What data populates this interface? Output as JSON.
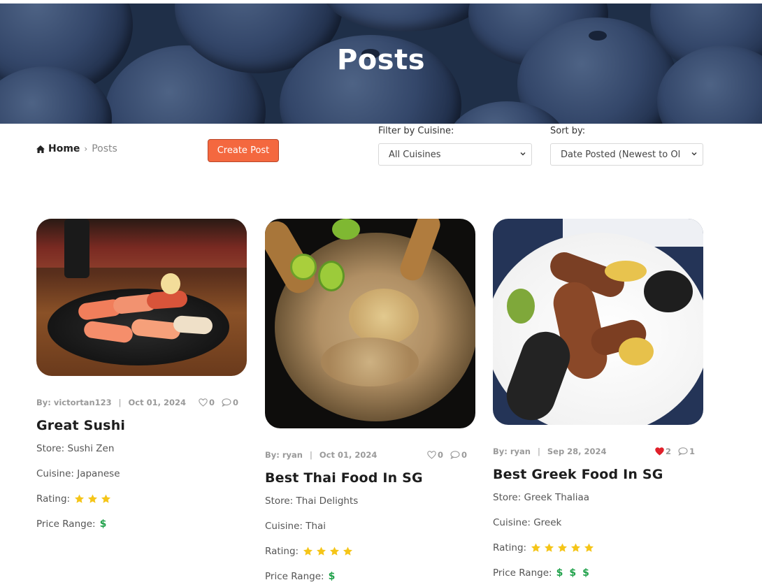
{
  "hero": {
    "title": "Posts"
  },
  "breadcrumb": {
    "home": "Home",
    "current": "Posts"
  },
  "toolbar": {
    "create_label": "Create Post",
    "filter_label": "Filter by Cuisine:",
    "filter_value": "All Cuisines",
    "sort_label": "Sort by:",
    "sort_value": "Date Posted (Newest to Ol"
  },
  "posts": [
    {
      "author": "By: victortan123",
      "date": "Oct 01, 2024",
      "likes": "0",
      "comments": "0",
      "liked": false,
      "title": "Great Sushi",
      "store": "Store: Sushi Zen",
      "cuisine": "Cuisine: Japanese",
      "rating_label": "Rating:",
      "rating": 3,
      "price_label": "Price Range:",
      "price": 1
    },
    {
      "author": "By: ryan",
      "date": "Oct 01, 2024",
      "likes": "0",
      "comments": "0",
      "liked": false,
      "title": "Best Thai Food In SG",
      "store": "Store: Thai Delights",
      "cuisine": "Cuisine: Thai",
      "rating_label": "Rating:",
      "rating": 4,
      "price_label": "Price Range:",
      "price": 1
    },
    {
      "author": "By: ryan",
      "date": "Sep 28, 2024",
      "likes": "2",
      "comments": "1",
      "liked": true,
      "title": "Best Greek Food In SG",
      "store": "Store: Greek Thaliaa",
      "cuisine": "Cuisine: Greek",
      "rating_label": "Rating:",
      "rating": 5,
      "price_label": "Price Range:",
      "price": 3
    }
  ],
  "icons": {
    "home": "home-icon",
    "breadcrumb_separator": "chevron-right-icon",
    "select_arrow": "chevron-down-icon",
    "like": "heart-icon",
    "comment": "comment-icon",
    "star": "star-icon",
    "price": "dollar-icon"
  },
  "colors": {
    "accent": "#f4683f",
    "star": "#f5c518",
    "price": "#22a24c",
    "liked_heart": "#e0202a",
    "hero_bg": "#1f2f48"
  }
}
